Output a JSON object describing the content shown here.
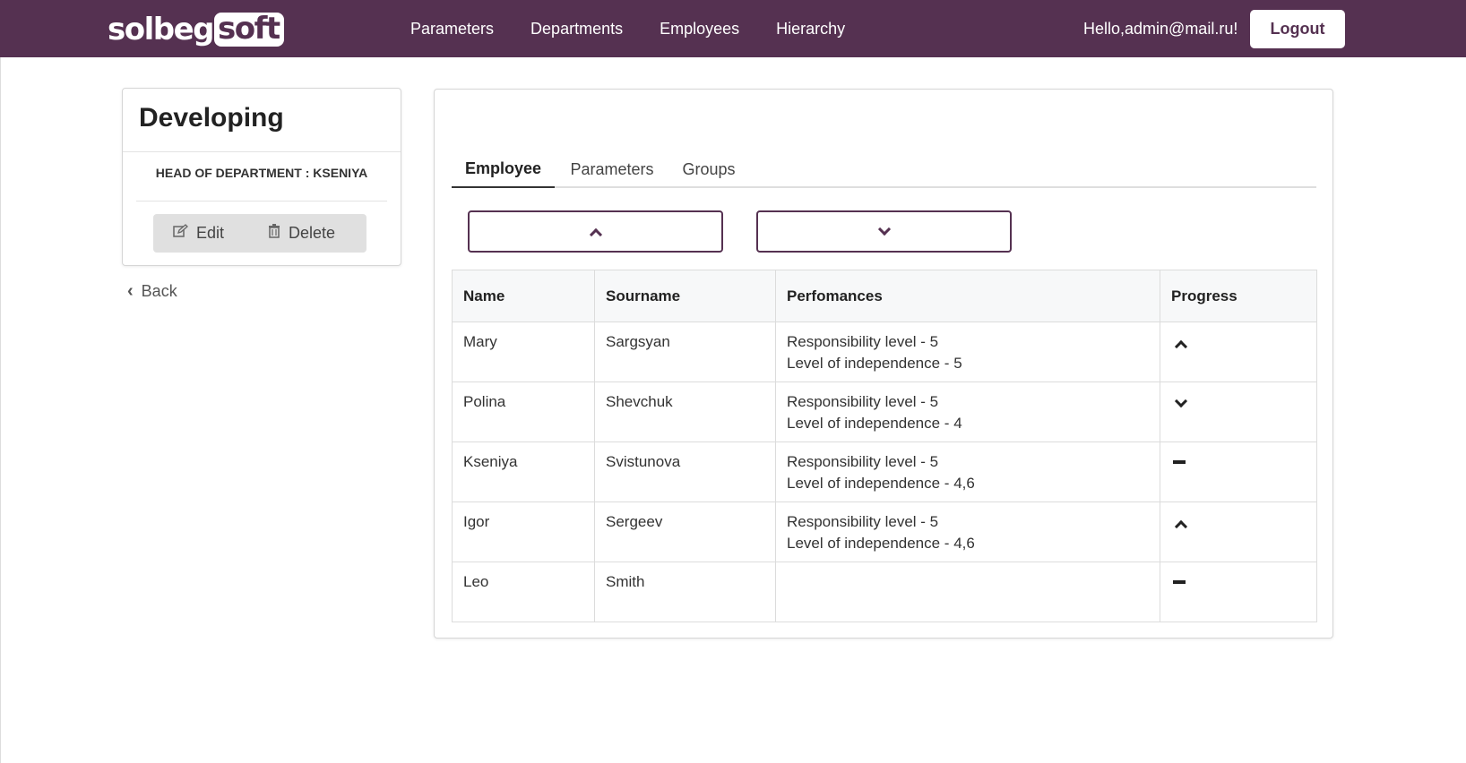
{
  "navbar": {
    "logo_part1": "solbeg",
    "logo_part2": "soft",
    "links": [
      "Parameters",
      "Departments",
      "Employees",
      "Hierarchy"
    ],
    "greeting": "Hello,admin@mail.ru!",
    "logout_label": "Logout",
    "background_color": "#553151"
  },
  "department": {
    "title": "Developing",
    "head_label": "HEAD OF DEPARTMENT : KSENIYA",
    "edit_label": "Edit",
    "delete_label": "Delete",
    "edit_icon": "edit-icon",
    "delete_icon": "trash-icon"
  },
  "back": {
    "label": "Back"
  },
  "tabs": [
    {
      "label": "Employee",
      "active": true
    },
    {
      "label": "Parameters",
      "active": false
    },
    {
      "label": "Groups",
      "active": false
    }
  ],
  "sort_buttons": {
    "up_icon": "chevron-up-icon",
    "down_icon": "chevron-down-icon"
  },
  "table": {
    "headers": [
      "Name",
      "Sourname",
      "Perfomances",
      "Progress"
    ],
    "rows": [
      {
        "name": "Mary",
        "surname": "Sargsyan",
        "perf1": "Responsibility level - 5",
        "perf2": "Level of independence - 5",
        "progress": "up"
      },
      {
        "name": "Polina",
        "surname": "Shevchuk",
        "perf1": "Responsibility level - 5",
        "perf2": "Level of independence - 4",
        "progress": "down"
      },
      {
        "name": "Kseniya",
        "surname": "Svistunova",
        "perf1": "Responsibility level - 5",
        "perf2": "Level of independence - 4,6",
        "progress": "flat"
      },
      {
        "name": "Igor",
        "surname": "Sergeev",
        "perf1": "Responsibility level - 5",
        "perf2": "Level of independence - 4,6",
        "progress": "up"
      },
      {
        "name": "Leo",
        "surname": "Smith",
        "perf1": "",
        "perf2": "",
        "progress": "flat"
      }
    ]
  }
}
